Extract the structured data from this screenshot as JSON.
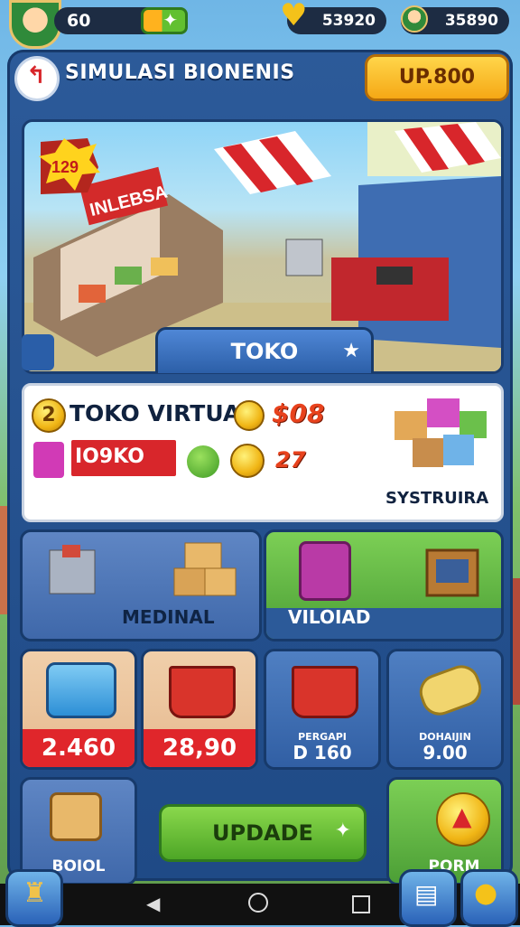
{
  "topbar": {
    "level": "60",
    "currency_1": "53920",
    "currency_2": "35890"
  },
  "header": {
    "title": "SIMULASI BIONENIS",
    "upgrade_button": "UP.800"
  },
  "scene": {
    "shop_sign": "INLEBSA",
    "badge": "129",
    "tab_label": "TOKO"
  },
  "info_panel": {
    "rank": "2",
    "store_name": "TOKO VIRTUAL",
    "price_1": "$08",
    "input_value": "IO9KO",
    "price_2": "27",
    "caption": "SYSTRUIRA"
  },
  "categories": [
    {
      "label": "MEDINAL"
    },
    {
      "label": "VILOIAD"
    }
  ],
  "products": [
    {
      "price": "2.460"
    },
    {
      "price": "28,90"
    },
    {
      "line1": "PERGAPI",
      "line2": "D 160"
    },
    {
      "line1": "DOHAIJIN",
      "line2": "9.00"
    }
  ],
  "bottom": {
    "left_label": "BOIOL",
    "update_button": "UPDADE",
    "right_label": "PORM"
  },
  "colors": {
    "frame": "#2c5a99",
    "price_red": "#e0262b",
    "price_blue": "#2a62b8",
    "button_green": "#6cc238",
    "button_yellow": "#ffc52b"
  }
}
